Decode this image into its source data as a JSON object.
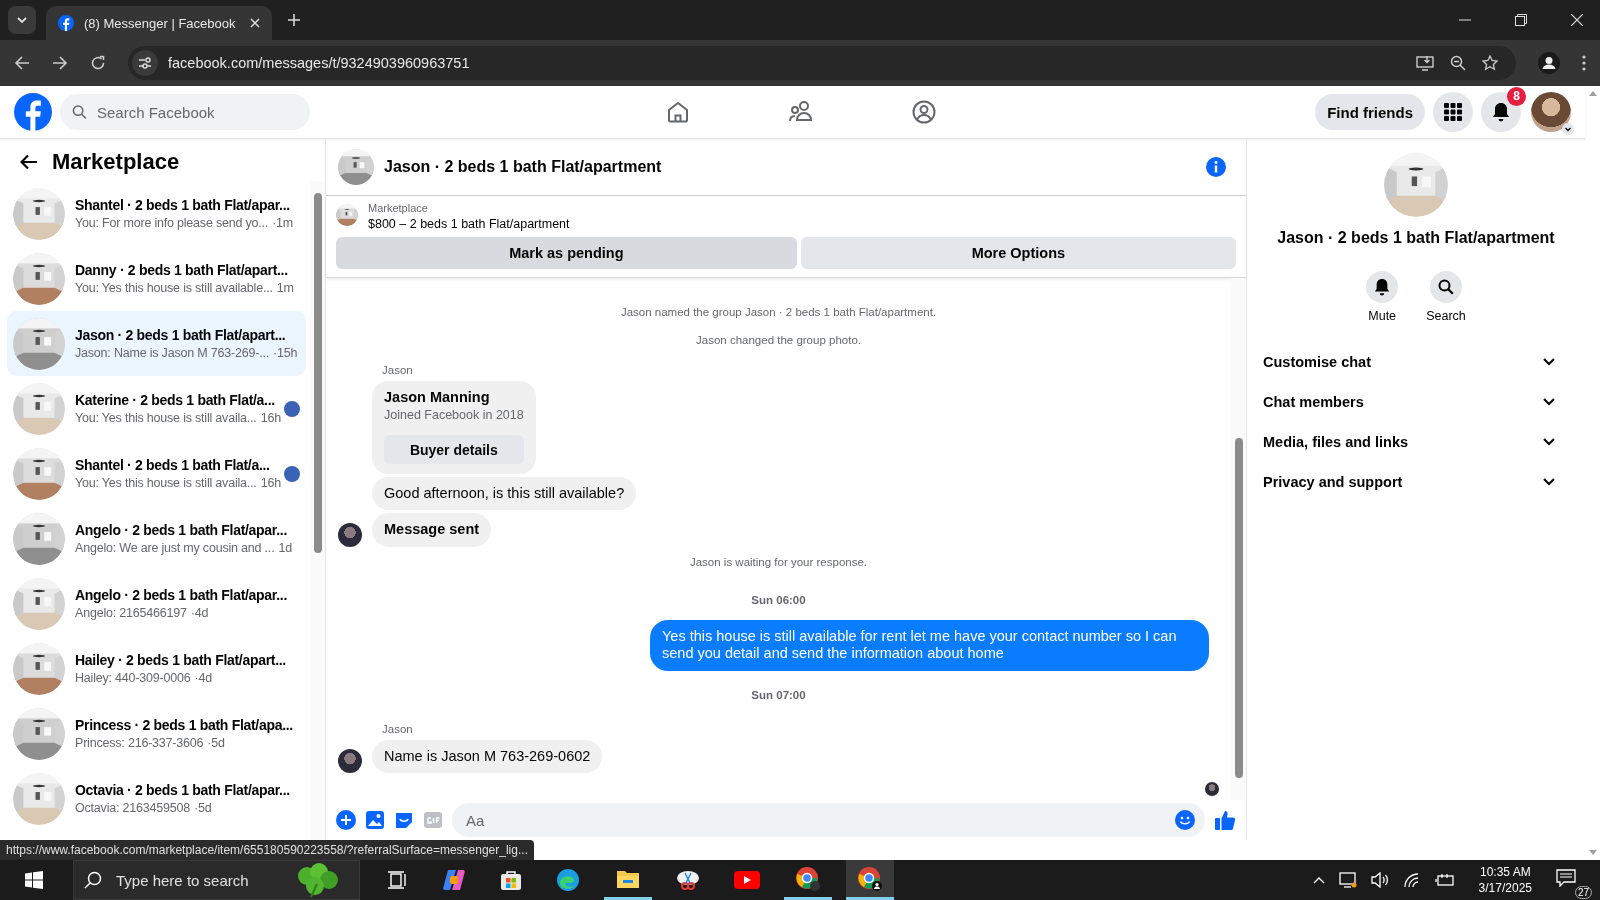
{
  "browser": {
    "tab_title": "(8) Messenger | Facebook",
    "url": "facebook.com/messages/t/9324903960963751"
  },
  "header": {
    "search_placeholder": "Search Facebook",
    "find_friends": "Find friends",
    "notification_count": "8"
  },
  "sidebar": {
    "title": "Marketplace",
    "conversations": [
      {
        "title": "Shantel · 2 beds 1 bath Flat/apar...",
        "preview": "You: For more info please send yo...",
        "time": "·1m",
        "selected": false,
        "seen": false
      },
      {
        "title": "Danny · 2 beds 1 bath Flat/apart...",
        "preview": "You: Yes this house is still available...",
        "time": "1m",
        "selected": false,
        "seen": false
      },
      {
        "title": "Jason · 2 beds 1 bath Flat/apart...",
        "preview": "Jason: Name is Jason M 763-269-...",
        "time": "·15h",
        "selected": true,
        "seen": false
      },
      {
        "title": "Katerine · 2 beds 1 bath Flat/a...",
        "preview": "You: Yes this house is still availa...",
        "time": "16h",
        "selected": false,
        "seen": true
      },
      {
        "title": "Shantel · 2 beds 1 bath Flat/a...",
        "preview": "You: Yes this house is still availa...",
        "time": "16h",
        "selected": false,
        "seen": true
      },
      {
        "title": "Angelo · 2 beds 1 bath Flat/apar...",
        "preview": "Angelo: We are just my cousin and ...",
        "time": "1d",
        "selected": false,
        "seen": false
      },
      {
        "title": "Angelo · 2 beds 1 bath Flat/apar...",
        "preview": "Angelo: 2165466197",
        "time": "·4d",
        "selected": false,
        "seen": false
      },
      {
        "title": "Hailey · 2 beds 1 bath Flat/apart...",
        "preview": "Hailey: 440-309-0006",
        "time": "·4d",
        "selected": false,
        "seen": false
      },
      {
        "title": "Princess · 2 beds 1 bath Flat/apa...",
        "preview": "Princess: 216-337-3606",
        "time": "·5d",
        "selected": false,
        "seen": false
      },
      {
        "title": "Octavia · 2 beds 1 bath Flat/apar...",
        "preview": "Octavia: 2163459508",
        "time": "·5d",
        "selected": false,
        "seen": false
      }
    ]
  },
  "chat": {
    "title": "Jason · 2 beds 1 bath Flat/apartment",
    "listing": {
      "label": "Marketplace",
      "title": "$800 – 2 beds 1 bath Flat/apartment"
    },
    "actions": [
      "Mark as pending",
      "More Options"
    ],
    "messages": [
      {
        "kind": "event",
        "text": "Jason named the group Jason · 2 beds 1 bath Flat/apartment."
      },
      {
        "kind": "event",
        "text": "Jason changed the group photo."
      },
      {
        "kind": "sender",
        "text": "Jason"
      },
      {
        "kind": "card",
        "name": "Jason Manning",
        "subtitle": "Joined Facebook in 2018",
        "button": "Buyer details"
      },
      {
        "kind": "incoming",
        "text": "Good afternoon, is this still available?",
        "bold": false,
        "avatar": false
      },
      {
        "kind": "incoming",
        "text": "Message sent",
        "bold": true,
        "avatar": true
      },
      {
        "kind": "event",
        "text": "Jason is waiting for your response."
      },
      {
        "kind": "timestamp",
        "text": "Sun 06:00"
      },
      {
        "kind": "outgoing",
        "text": "Yes this house is still available for rent let me have your contact number so I can send you detail and send the information about home"
      },
      {
        "kind": "timestamp",
        "text": "Sun 07:00"
      },
      {
        "kind": "sender",
        "text": "Jason"
      },
      {
        "kind": "incoming",
        "text": "Name is Jason M  763-269-0602",
        "bold": false,
        "avatar": true
      }
    ],
    "read_receipt": true,
    "composer_placeholder": "Aa"
  },
  "details": {
    "title": "Jason · 2 beds 1 bath Flat/apartment",
    "actions": [
      {
        "label": "Mute",
        "kind": "mute"
      },
      {
        "label": "Search",
        "kind": "search"
      }
    ],
    "sections": [
      {
        "label": "Customise chat",
        "expanded": false
      },
      {
        "label": "Chat members",
        "expanded": false
      },
      {
        "label": "Media, files and links",
        "expanded": false
      },
      {
        "label": "Privacy and support",
        "expanded": false
      }
    ]
  },
  "status_url": "https://www.facebook.com/marketplace/item/655180590223558/?referralSurface=messenger_lig...",
  "taskbar": {
    "search_placeholder": "Type here to search",
    "time": "10:35 AM",
    "date": "3/17/2025",
    "notification_count": "27"
  }
}
